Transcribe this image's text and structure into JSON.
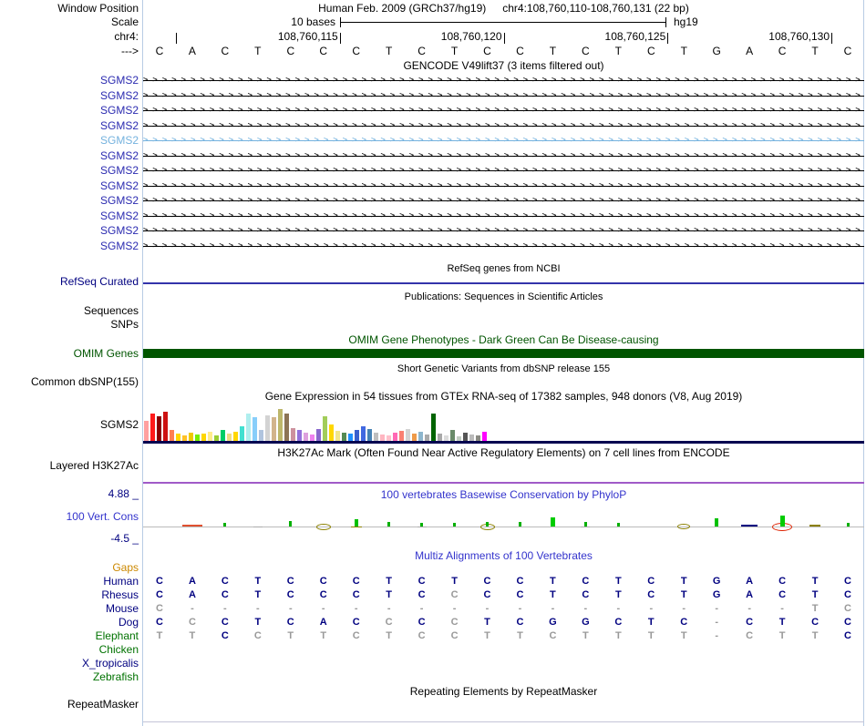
{
  "colors": {
    "guideline": "#B8CCE4",
    "gencode_label": "#2A2AB0",
    "gencode_highlight": "#74B2DE",
    "refseq_line": "#3333AA",
    "omim_green": "#005500",
    "gtex_baseline": "#000050",
    "h3k27ac_line": "#A05AC8",
    "phylop_blue": "#3333CC",
    "gaps_orange": "#CC8800",
    "species_navy": "#000080",
    "species_green": "#007200",
    "letter_dark": "#000080",
    "letter_grey": "#999999"
  },
  "header": {
    "window_position_label": "Window Position",
    "title_left": "Human Feb. 2009 (GRCh37/hg19)",
    "title_right": "chr4:108,760,110-108,760,131 (22 bp)",
    "scale_label": "Scale",
    "scale_caption": "10 bases",
    "assembly": "hg19",
    "chrom_label": "chr4:",
    "direction_label": "--->",
    "coordinate_ticks": [
      {
        "label": "",
        "base_index": 0
      },
      {
        "label": "108,760,115",
        "base_index": 5
      },
      {
        "label": "108,760,120",
        "base_index": 10
      },
      {
        "label": "108,760,125",
        "base_index": 15
      },
      {
        "label": "108,760,130",
        "base_index": 20
      }
    ],
    "bases": "CACTCCCTCTCCTCTCTGACTC"
  },
  "gencode": {
    "title": "GENCODE V49lift37 (3 items filtered out)",
    "rows": [
      {
        "label": "SGMS2",
        "highlight": false
      },
      {
        "label": "SGMS2",
        "highlight": false
      },
      {
        "label": "SGMS2",
        "highlight": false
      },
      {
        "label": "SGMS2",
        "highlight": false
      },
      {
        "label": "SGMS2",
        "highlight": true
      },
      {
        "label": "SGMS2",
        "highlight": false
      },
      {
        "label": "SGMS2",
        "highlight": false
      },
      {
        "label": "SGMS2",
        "highlight": false
      },
      {
        "label": "SGMS2",
        "highlight": false
      },
      {
        "label": "SGMS2",
        "highlight": false
      },
      {
        "label": "SGMS2",
        "highlight": false
      },
      {
        "label": "SGMS2",
        "highlight": false
      }
    ]
  },
  "refseq": {
    "title": "RefSeq genes from NCBI",
    "label": "RefSeq Curated"
  },
  "publications": {
    "title": "Publications: Sequences in Scientific Articles",
    "row_labels": [
      "Sequences",
      "SNPs"
    ]
  },
  "omim": {
    "title": "OMIM Gene Phenotypes - Dark Green Can Be Disease-causing",
    "label": "OMIM Genes"
  },
  "dbsnp": {
    "title": "Short Genetic Variants from dbSNP release 155",
    "label": "Common dbSNP(155)"
  },
  "gtex": {
    "title": "Gene Expression in 54 tissues from GTEx RNA-seq of 17382 samples, 948 donors (V8, Aug 2019)",
    "label": "SGMS2",
    "bars": [
      [
        22,
        "#FFA0A0"
      ],
      [
        30,
        "#FF1A1A"
      ],
      [
        27,
        "#8B0000"
      ],
      [
        32,
        "#CD1111"
      ],
      [
        12,
        "#FF7F50"
      ],
      [
        8,
        "#FFD700"
      ],
      [
        6,
        "#FFC125"
      ],
      [
        9,
        "#EEC900"
      ],
      [
        7,
        "#76EE00"
      ],
      [
        8,
        "#FFD700"
      ],
      [
        10,
        "#FFEC8B"
      ],
      [
        6,
        "#9ACD32"
      ],
      [
        12,
        "#00CD66"
      ],
      [
        8,
        "#EEDC82"
      ],
      [
        10,
        "#FFD700"
      ],
      [
        16,
        "#40E0D0"
      ],
      [
        30,
        "#AFEEEE"
      ],
      [
        26,
        "#87CEFA"
      ],
      [
        12,
        "#B0C4DE"
      ],
      [
        28,
        "#D3D3D3"
      ],
      [
        26,
        "#D2B48C"
      ],
      [
        35,
        "#BDB76B"
      ],
      [
        30,
        "#8B7355"
      ],
      [
        14,
        "#CD919E"
      ],
      [
        12,
        "#9370DB"
      ],
      [
        9,
        "#DDA0DD"
      ],
      [
        7,
        "#EE82EE"
      ],
      [
        13,
        "#8968CD"
      ],
      [
        27,
        "#A2CD5A"
      ],
      [
        18,
        "#FFD700"
      ],
      [
        11,
        "#F0E68C"
      ],
      [
        9,
        "#548B54"
      ],
      [
        8,
        "#1E90FF"
      ],
      [
        12,
        "#3A5FCD"
      ],
      [
        16,
        "#4169E1"
      ],
      [
        13,
        "#4682B4"
      ],
      [
        9,
        "#BEBEBE"
      ],
      [
        7,
        "#FFB6C1"
      ],
      [
        6,
        "#FFC0CB"
      ],
      [
        9,
        "#FF69B4"
      ],
      [
        11,
        "#FA8072"
      ],
      [
        13,
        "#D3D3D3"
      ],
      [
        8,
        "#EE9A49"
      ],
      [
        10,
        "#8DB6CD"
      ],
      [
        7,
        "#A9A9A9"
      ],
      [
        30,
        "#006400"
      ],
      [
        8,
        "#A9A9A9"
      ],
      [
        6,
        "#DCDCDC"
      ],
      [
        12,
        "#698B69"
      ],
      [
        5,
        "#C1CDC1"
      ],
      [
        9,
        "#555555"
      ],
      [
        7,
        "#BBBBBB"
      ],
      [
        6,
        "#8B8B83"
      ],
      [
        10,
        "#FF00FF"
      ]
    ]
  },
  "h3k27ac": {
    "title": "H3K27Ac Mark (Often Found Near Active Regulatory Elements) on 7 cell lines from ENCODE",
    "label": "Layered H3K27Ac"
  },
  "phylop": {
    "title": "100 vertebrates Basewise Conservation by PhyloP",
    "label": "100 Vert. Cons",
    "max_label": "4.88 _",
    "min_label": "-4.5 _",
    "marks": [
      {
        "col": 1,
        "kind": "dash",
        "color": "#E05030",
        "w": 22,
        "h": 2,
        "dy": -1
      },
      {
        "col": 2,
        "kind": "bar",
        "color": "#00B000",
        "w": 3,
        "h": 4
      },
      {
        "col": 3,
        "kind": "dash",
        "color": "#AAAAAA",
        "w": 10,
        "h": 1,
        "dy": 0
      },
      {
        "col": 4,
        "kind": "bar",
        "color": "#00B000",
        "w": 3,
        "h": 6
      },
      {
        "col": 5,
        "kind": "arc",
        "color": "#8B8000",
        "w": 16,
        "h": 7
      },
      {
        "col": 6,
        "kind": "bar",
        "color": "#00C000",
        "w": 4,
        "h": 8
      },
      {
        "col": 6,
        "kind": "dash",
        "color": "#8B8000",
        "w": 12,
        "h": 1,
        "dy": 0
      },
      {
        "col": 7,
        "kind": "bar",
        "color": "#00B000",
        "w": 3,
        "h": 5
      },
      {
        "col": 8,
        "kind": "dash",
        "color": "#AAAAAA",
        "w": 10,
        "h": 1,
        "dy": 0
      },
      {
        "col": 8,
        "kind": "bar",
        "color": "#00B000",
        "w": 3,
        "h": 4
      },
      {
        "col": 9,
        "kind": "bar",
        "color": "#00B000",
        "w": 3,
        "h": 4
      },
      {
        "col": 10,
        "kind": "arc",
        "color": "#8B8000",
        "w": 16,
        "h": 7
      },
      {
        "col": 10,
        "kind": "bar",
        "color": "#00B000",
        "w": 3,
        "h": 5
      },
      {
        "col": 11,
        "kind": "bar",
        "color": "#00B000",
        "w": 3,
        "h": 5
      },
      {
        "col": 12,
        "kind": "bar",
        "color": "#00CC00",
        "w": 5,
        "h": 10
      },
      {
        "col": 13,
        "kind": "bar",
        "color": "#00B000",
        "w": 3,
        "h": 5
      },
      {
        "col": 13,
        "kind": "dash",
        "color": "#AAAAAA",
        "w": 10,
        "h": 1,
        "dy": 0
      },
      {
        "col": 14,
        "kind": "bar",
        "color": "#00B000",
        "w": 3,
        "h": 4
      },
      {
        "col": 16,
        "kind": "arc",
        "color": "#8B8000",
        "w": 14,
        "h": 6
      },
      {
        "col": 17,
        "kind": "bar",
        "color": "#00C000",
        "w": 4,
        "h": 9
      },
      {
        "col": 18,
        "kind": "dash",
        "color": "#000080",
        "w": 18,
        "h": 2,
        "dy": -1
      },
      {
        "col": 19,
        "kind": "arc",
        "color": "#DD2200",
        "w": 22,
        "h": 9
      },
      {
        "col": 19,
        "kind": "bar",
        "color": "#00CC00",
        "w": 5,
        "h": 12
      },
      {
        "col": 20,
        "kind": "dash",
        "color": "#8B8000",
        "w": 12,
        "h": 2,
        "dy": -1
      },
      {
        "col": 21,
        "kind": "bar",
        "color": "#00B000",
        "w": 3,
        "h": 4
      }
    ]
  },
  "multiz": {
    "title": "Multiz Alignments of 100 Vertebrates",
    "rows": [
      {
        "name": "Gaps",
        "color_key": "gaps_orange",
        "seq": "",
        "shades": ""
      },
      {
        "name": "Human",
        "color_key": "species_navy",
        "seq": "CACTCCCTCTCCTCTCTGACTC",
        "shades": "dddddddddddddddddddddd"
      },
      {
        "name": "Rhesus",
        "color_key": "species_navy",
        "seq": "CACTCCCTCCCCTCTCTGACTC",
        "shades": "dddddddddgdddddddddddd"
      },
      {
        "name": "Mouse",
        "color_key": "species_navy",
        "seq": "C-------------------TC",
        "shades": "gggggggggggggggggggggg"
      },
      {
        "name": "Dog",
        "color_key": "species_navy",
        "seq": "CCCTCACCCCTCGGCTC-CTCC",
        "shades": "dgdddddgdgdddddddgdddd"
      },
      {
        "name": "Elephant",
        "color_key": "species_green",
        "seq": "TTCCTTCTCCTTCTTTT-CTTC",
        "shades": "ggdggggggggggggggggggd"
      },
      {
        "name": "Chicken",
        "color_key": "species_green",
        "seq": "",
        "shades": ""
      },
      {
        "name": "X_tropicalis",
        "color_key": "species_navy",
        "seq": "",
        "shades": ""
      },
      {
        "name": "Zebrafish",
        "color_key": "species_green",
        "seq": "",
        "shades": ""
      }
    ]
  },
  "repeatmasker": {
    "title": "Repeating Elements by RepeatMasker",
    "label": "RepeatMasker"
  }
}
